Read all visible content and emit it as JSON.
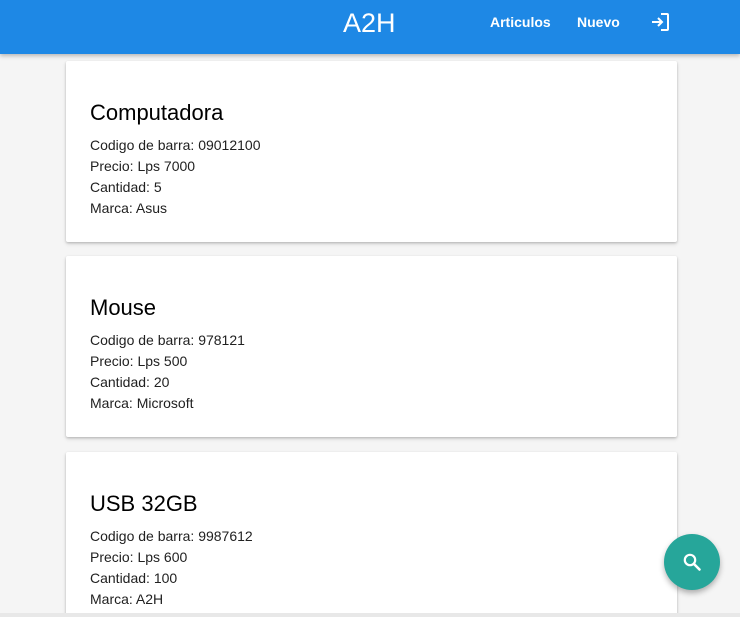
{
  "header": {
    "brand": "A2H",
    "nav": [
      {
        "label": "Articulos"
      },
      {
        "label": "Nuevo"
      }
    ],
    "logout_icon": "logout-icon",
    "color": "#1e88e5"
  },
  "labels": {
    "barcode": "Codigo de barra:",
    "price": "Precio:",
    "quantity": "Cantidad:",
    "brand": "Marca:"
  },
  "products": [
    {
      "name": "Computadora",
      "barcode": "09012100",
      "price": "Lps 7000",
      "quantity": "5",
      "brand": "Asus"
    },
    {
      "name": "Mouse",
      "barcode": "978121",
      "price": "Lps 500",
      "quantity": "20",
      "brand": "Microsoft"
    },
    {
      "name": "USB 32GB",
      "barcode": "9987612",
      "price": "Lps 600",
      "quantity": "100",
      "brand": "A2H"
    }
  ],
  "fab": {
    "icon": "search-icon",
    "color": "#26a69a"
  }
}
